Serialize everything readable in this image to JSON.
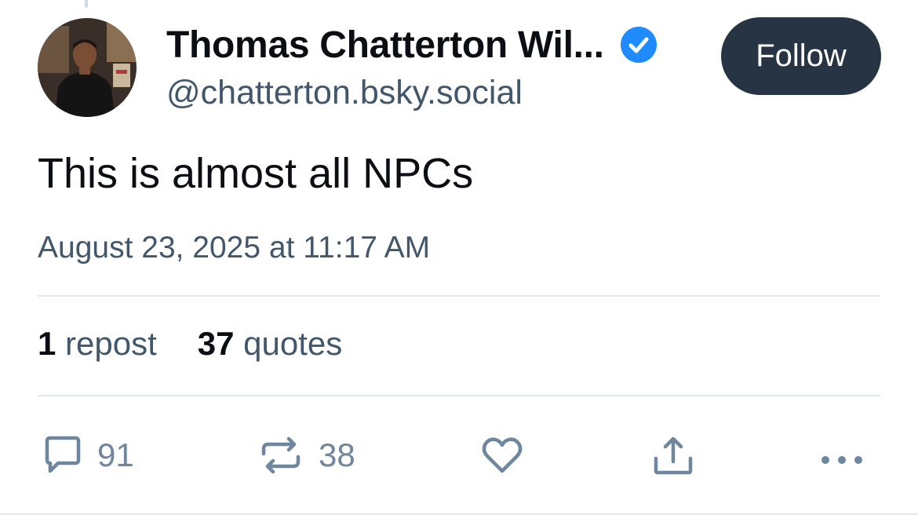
{
  "colors": {
    "text_primary": "#0b0f14",
    "text_secondary": "#42576c",
    "action_icon": "#6f869f",
    "verified_badge": "#208bfe",
    "follow_button_bg": "#263443",
    "follow_button_text": "#ffffff",
    "divider": "#e4e9ee"
  },
  "author": {
    "display_name": "Thomas Chatterton Wil...",
    "handle": "@chatterton.bsky.social",
    "verified": true,
    "avatar_icon": "user-avatar-photo"
  },
  "follow_button": {
    "label": "Follow"
  },
  "post": {
    "text": "This is almost all NPCs",
    "timestamp": "August 23, 2025 at 11:17 AM"
  },
  "stats": {
    "reposts": {
      "count": "1",
      "label": "repost"
    },
    "quotes": {
      "count": "37",
      "label": "quotes"
    }
  },
  "actions": {
    "reply": {
      "icon": "reply-icon",
      "count": "91"
    },
    "repost": {
      "icon": "repost-icon",
      "count": "38"
    },
    "like": {
      "icon": "heart-icon",
      "count": ""
    },
    "share": {
      "icon": "share-icon"
    },
    "more": {
      "icon": "more-icon"
    }
  }
}
